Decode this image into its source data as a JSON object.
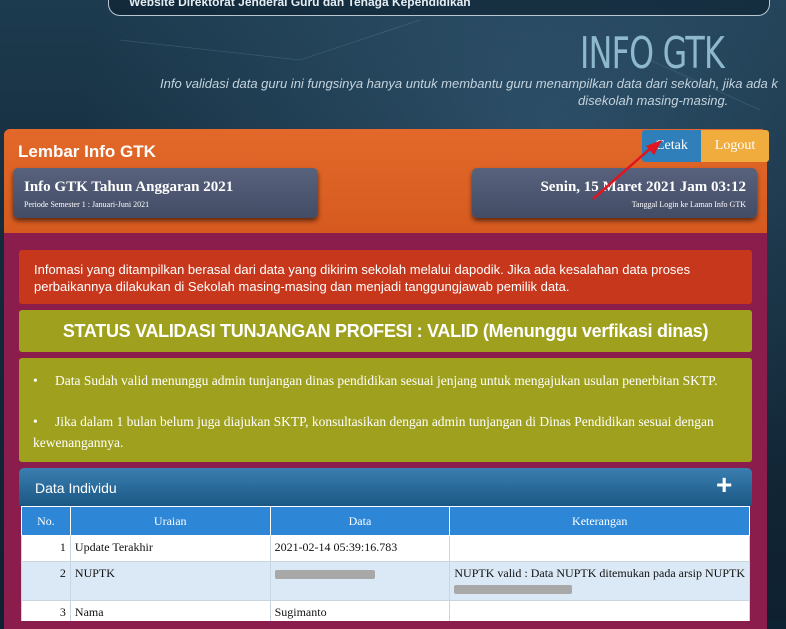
{
  "header": {
    "top_bar_text": "Website Direktorat Jenderal Guru dan Tenaga Kependidikan",
    "brand": "INFO GTK",
    "tagline_line1": "Info validasi data guru ini fungsinya hanya untuk membantu guru menampilkan data dari sekolah, jika ada k",
    "tagline_line2": "disekolah masing-masing."
  },
  "panel": {
    "title": "Lembar Info GTK",
    "buttons": {
      "cetak": "Cetak",
      "logout": "Logout"
    },
    "year_card": {
      "title": "Info GTK Tahun Anggaran 2021",
      "subtitle": "Periode Semester 1 : Januari-Juni 2021"
    },
    "login_card": {
      "title": "Senin, 15 Maret 2021 Jam 03:12",
      "subtitle": "Tanggal Login ke Laman Info GTK"
    }
  },
  "alert": {
    "text": "Infomasi yang ditampilkan berasal dari data yang dikirim sekolah melalui dapodik. Jika ada kesalahan data proses perbaikannya dilakukan di Sekolah masing-masing dan menjadi tanggungjawab pemilik data."
  },
  "status": {
    "text": "STATUS VALIDASI TUNJANGAN PROFESI : VALID (Menunggu verfikasi dinas)"
  },
  "notes": {
    "items": [
      "Data Sudah valid menunggu admin tunjangan dinas pendidikan sesuai jenjang untuk mengajukan usulan penerbitan SKTP.",
      "Jika dalam 1 bulan belum juga diajukan SKTP, konsultasikan dengan admin tunjangan di Dinas Pendidikan sesuai dengan kewenangannya."
    ],
    "bullet": "•"
  },
  "data_individu": {
    "title": "Data Individu",
    "expand_icon": "plus-icon",
    "columns": [
      "No.",
      "Uraian",
      "Data",
      "Keterangan"
    ],
    "rows": [
      {
        "no": "1",
        "uraian": "Update Terakhir",
        "data": "2021-02-14 05:39:16.783",
        "keterangan": ""
      },
      {
        "no": "2",
        "uraian": "NUPTK",
        "data": "",
        "keterangan": "NUPTK valid : Data NUPTK ditemukan pada arsip NUPTK"
      },
      {
        "no": "3",
        "uraian": "Nama",
        "data": "Sugimanto",
        "keterangan": ""
      }
    ]
  },
  "colors": {
    "panel_orange": "#e2692a",
    "panel_maroon": "#8b1d4c",
    "cetak_blue": "#2f7fba",
    "logout_orange": "#f0ac3c",
    "alert_red": "#c6371c",
    "status_olive": "#9fa11e",
    "table_header_blue": "#2d86d6"
  }
}
